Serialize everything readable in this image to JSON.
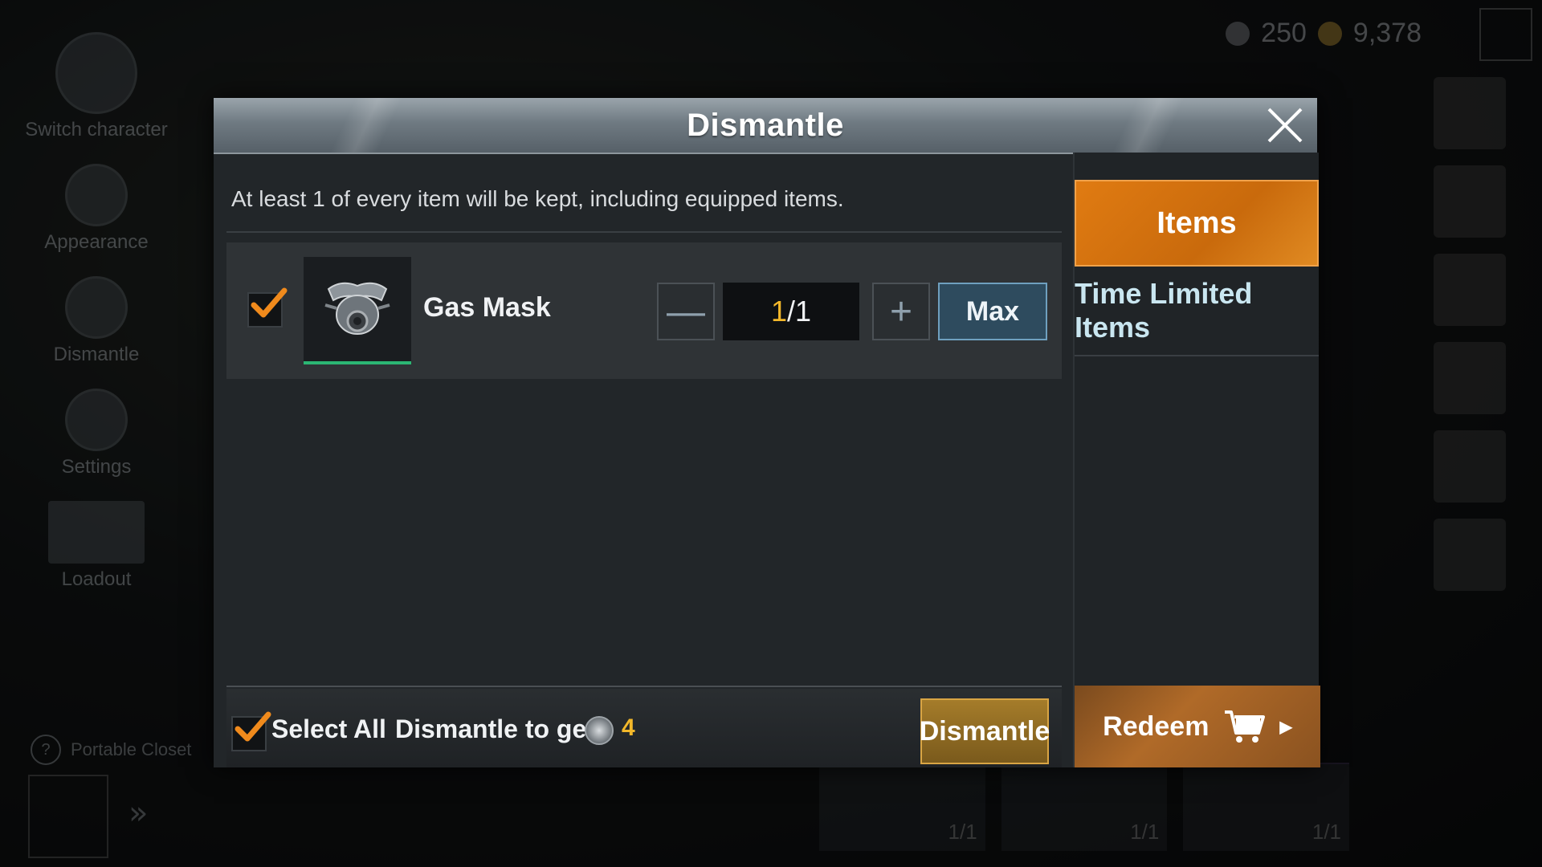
{
  "background": {
    "side_menu": [
      {
        "label": "Switch character",
        "icon": "helmet-icon"
      },
      {
        "label": "Appearance",
        "icon": "refresh-icon"
      },
      {
        "label": "Dismantle",
        "icon": "dismantle-icon"
      },
      {
        "label": "Settings",
        "icon": "gear-icon"
      },
      {
        "label": "Loadout",
        "icon": "crate-icon"
      }
    ],
    "portable_closet": "Portable Closet",
    "currency_bp": "250",
    "currency_coins": "9,378",
    "grid_counts": [
      "1/1",
      "1/1",
      "1/1"
    ]
  },
  "dialog": {
    "title": "Dismantle",
    "notice": "At least 1 of every item will be kept, including equipped items.",
    "items": [
      {
        "name": "Gas Mask",
        "qty_current": "1",
        "qty_total": "/1",
        "checked": true
      }
    ],
    "max_label": "Max",
    "select_all_label": "Select All",
    "dismantle_to_get_label": "Dismantle to get:",
    "dismantle_to_get_value": "4",
    "dismantle_button_label": "Dismantle",
    "tabs": {
      "items": "Items",
      "time_limited": "Time Limited Items"
    },
    "redeem_label": "Redeem"
  },
  "colors": {
    "accent_orange": "#e07b12",
    "rarity_green": "#2bb673",
    "qty_yellow": "#f2b72a",
    "max_blue": "#2e4b5e"
  }
}
